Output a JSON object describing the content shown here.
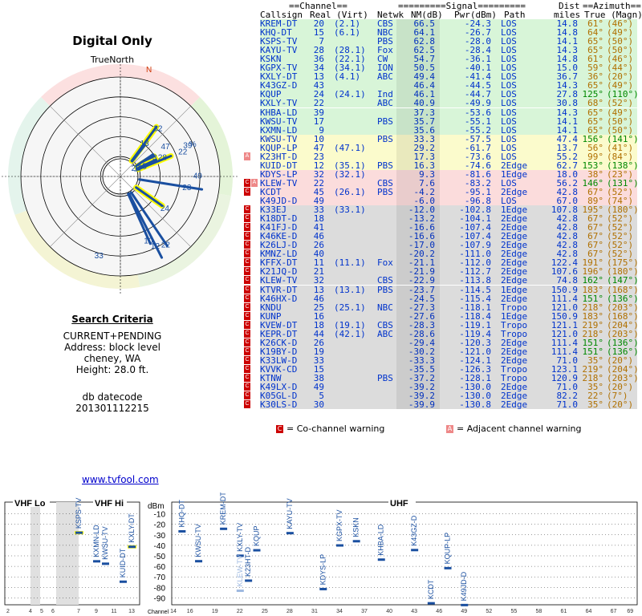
{
  "title": "Digital Only",
  "true_north": "TrueNorth",
  "north_letter": "N",
  "criteria": {
    "heading": "Search Criteria",
    "lines": [
      "CURRENT+PENDING",
      "Address: block level",
      "cheney, WA",
      "Height: 28.0 ft."
    ],
    "db_label": "db datecode",
    "db_code": "201301112215"
  },
  "link": "www.tvfool.com",
  "table": {
    "headers": {
      "channel_group": "==Channel==",
      "signal_group": "=========Signal=========",
      "dist": "Dist",
      "azimuth_group": "==Azimuth==",
      "callsign": "Callsign",
      "real_virt": "Real (Virt)",
      "netwk": "Netwk",
      "nm": "NM(dB)",
      "pwr": "Pwr(dBm)",
      "path": "Path",
      "miles": "miles",
      "true_magn": "True (Magn)"
    },
    "rows": [
      {
        "call": "KREM-DT",
        "real": "20",
        "virt": "(2.1)",
        "net": "CBS",
        "nm": "66.5",
        "pwr": "-24.3",
        "path": "LOS",
        "dist": "14.8",
        "tru": "61°",
        "mag": "(46°)",
        "warn": "",
        "bg": "#d8f5d8"
      },
      {
        "call": "KHQ-DT",
        "real": "15",
        "virt": "(6.1)",
        "net": "NBC",
        "nm": "64.1",
        "pwr": "-26.7",
        "path": "LOS",
        "dist": "14.8",
        "tru": "64°",
        "mag": "(49°)",
        "warn": "",
        "bg": "#d8f5d8"
      },
      {
        "call": "KSPS-TV",
        "real": "7",
        "virt": "",
        "net": "PBS",
        "nm": "62.8",
        "pwr": "-28.0",
        "path": "LOS",
        "dist": "14.1",
        "tru": "65°",
        "mag": "(50°)",
        "warn": "",
        "bg": "#d8f5d8"
      },
      {
        "call": "KAYU-TV",
        "real": "28",
        "virt": "(28.1)",
        "net": "Fox",
        "nm": "62.5",
        "pwr": "-28.4",
        "path": "LOS",
        "dist": "14.3",
        "tru": "65°",
        "mag": "(50°)",
        "warn": "",
        "bg": "#d8f5d8"
      },
      {
        "call": "KSKN",
        "real": "36",
        "virt": "(22.1)",
        "net": "CW",
        "nm": "54.7",
        "pwr": "-36.1",
        "path": "LOS",
        "dist": "14.8",
        "tru": "61°",
        "mag": "(46°)",
        "warn": "",
        "bg": "#d8f5d8"
      },
      {
        "call": "KGPX-TV",
        "real": "34",
        "virt": "(34.1)",
        "net": "ION",
        "nm": "50.5",
        "pwr": "-40.1",
        "path": "LOS",
        "dist": "15.0",
        "tru": "59°",
        "mag": "(44°)",
        "warn": "",
        "bg": "#d8f5d8"
      },
      {
        "call": "KXLY-DT",
        "real": "13",
        "virt": "(4.1)",
        "net": "ABC",
        "nm": "49.4",
        "pwr": "-41.4",
        "path": "LOS",
        "dist": "36.7",
        "tru": "36°",
        "mag": "(20°)",
        "warn": "",
        "bg": "#d8f5d8"
      },
      {
        "call": "K43GZ-D",
        "real": "43",
        "virt": "",
        "net": "",
        "nm": "46.4",
        "pwr": "-44.5",
        "path": "LOS",
        "dist": "14.3",
        "tru": "65°",
        "mag": "(49°)",
        "warn": "",
        "bg": "#d8f5d8"
      },
      {
        "call": "KQUP",
        "real": "24",
        "virt": "(24.1)",
        "net": "Ind",
        "nm": "46.1",
        "pwr": "-44.7",
        "path": "LOS",
        "dist": "27.8",
        "tru": "125°",
        "mag": "(110°)",
        "warn": "",
        "bg": "#d8f5d8"
      },
      {
        "call": "KXLY-TV",
        "real": "22",
        "virt": "",
        "net": "ABC",
        "nm": "40.9",
        "pwr": "-49.9",
        "path": "LOS",
        "dist": "30.8",
        "tru": "68°",
        "mag": "(52°)",
        "warn": "",
        "bg": "#d8f5d8"
      },
      {
        "call": "KHBA-LD",
        "real": "39",
        "virt": "",
        "net": "",
        "nm": "37.3",
        "pwr": "-53.6",
        "path": "LOS",
        "dist": "14.3",
        "tru": "65°",
        "mag": "(49°)",
        "warn": "",
        "bg": "#d8f5d8"
      },
      {
        "call": "KWSU-TV",
        "real": "17",
        "virt": "",
        "net": "PBS",
        "nm": "35.7",
        "pwr": "-55.1",
        "path": "LOS",
        "dist": "14.1",
        "tru": "65°",
        "mag": "(50°)",
        "warn": "",
        "bg": "#d8f5d8"
      },
      {
        "call": "KXMN-LD",
        "real": "9",
        "virt": "",
        "net": "",
        "nm": "35.6",
        "pwr": "-55.2",
        "path": "LOS",
        "dist": "14.1",
        "tru": "65°",
        "mag": "(50°)",
        "warn": "",
        "bg": "#d8f5d8"
      },
      {
        "call": "KWSU-TV",
        "real": "10",
        "virt": "",
        "net": "PBS",
        "nm": "33.3",
        "pwr": "-57.5",
        "path": "LOS",
        "dist": "47.4",
        "tru": "156°",
        "mag": "(141°)",
        "warn": "",
        "bg": "#fbfbcc"
      },
      {
        "call": "KQUP-LP",
        "real": "47",
        "virt": "(47.1)",
        "net": "",
        "nm": "29.2",
        "pwr": "-61.7",
        "path": "LOS",
        "dist": "13.7",
        "tru": "56°",
        "mag": "(41°)",
        "warn": "",
        "bg": "#fbfbcc"
      },
      {
        "call": "K23HT-D",
        "real": "23",
        "virt": "",
        "net": "",
        "nm": "17.3",
        "pwr": "-73.6",
        "path": "LOS",
        "dist": "55.2",
        "tru": "99°",
        "mag": "(84°)",
        "warn": "A",
        "bg": "#fbfbcc"
      },
      {
        "call": "KUID-DT",
        "real": "12",
        "virt": "(35.1)",
        "net": "PBS",
        "nm": "16.3",
        "pwr": "-74.6",
        "path": "2Edge",
        "dist": "62.7",
        "tru": "153°",
        "mag": "(138°)",
        "warn": "",
        "bg": "#fbfbcc"
      },
      {
        "call": "KDYS-LP",
        "real": "32",
        "virt": "(32.1)",
        "net": "",
        "nm": "9.3",
        "pwr": "-81.6",
        "path": "1Edge",
        "dist": "18.0",
        "tru": "38°",
        "mag": "(23°)",
        "warn": "",
        "bg": "#fbdcdc"
      },
      {
        "call": "KLEW-TV",
        "real": "22",
        "virt": "",
        "net": "CBS",
        "nm": "7.6",
        "pwr": "-83.2",
        "path": "LOS",
        "dist": "56.2",
        "tru": "146°",
        "mag": "(131°)",
        "warn": "CA",
        "bg": "#fbdcdc"
      },
      {
        "call": "KCDT",
        "real": "45",
        "virt": "(26.1)",
        "net": "PBS",
        "nm": "-4.2",
        "pwr": "-95.1",
        "path": "2Edge",
        "dist": "42.8",
        "tru": "67°",
        "mag": "(52°)",
        "warn": "C",
        "bg": "#fbdcdc"
      },
      {
        "call": "K49JD-D",
        "real": "49",
        "virt": "",
        "net": "",
        "nm": "-6.0",
        "pwr": "-96.8",
        "path": "LOS",
        "dist": "67.0",
        "tru": "89°",
        "mag": "(74°)",
        "warn": "",
        "bg": "#fbdcdc"
      },
      {
        "call": "K33EJ",
        "real": "33",
        "virt": "(33.1)",
        "net": "",
        "nm": "-12.0",
        "pwr": "-102.8",
        "path": "1Edge",
        "dist": "107.8",
        "tru": "195°",
        "mag": "(180°)",
        "warn": "C",
        "bg": "#dcdcdc"
      },
      {
        "call": "K18DT-D",
        "real": "18",
        "virt": "",
        "net": "",
        "nm": "-13.2",
        "pwr": "-104.1",
        "path": "2Edge",
        "dist": "42.8",
        "tru": "67°",
        "mag": "(52°)",
        "warn": "C",
        "bg": "#dcdcdc"
      },
      {
        "call": "K41FJ-D",
        "real": "41",
        "virt": "",
        "net": "",
        "nm": "-16.6",
        "pwr": "-107.4",
        "path": "2Edge",
        "dist": "42.8",
        "tru": "67°",
        "mag": "(52°)",
        "warn": "C",
        "bg": "#dcdcdc"
      },
      {
        "call": "K46KE-D",
        "real": "46",
        "virt": "",
        "net": "",
        "nm": "-16.6",
        "pwr": "-107.4",
        "path": "2Edge",
        "dist": "42.8",
        "tru": "67°",
        "mag": "(52°)",
        "warn": "C",
        "bg": "#dcdcdc"
      },
      {
        "call": "K26LJ-D",
        "real": "26",
        "virt": "",
        "net": "",
        "nm": "-17.0",
        "pwr": "-107.9",
        "path": "2Edge",
        "dist": "42.8",
        "tru": "67°",
        "mag": "(52°)",
        "warn": "C",
        "bg": "#dcdcdc"
      },
      {
        "call": "KMNZ-LD",
        "real": "40",
        "virt": "",
        "net": "",
        "nm": "-20.2",
        "pwr": "-111.0",
        "path": "2Edge",
        "dist": "42.8",
        "tru": "67°",
        "mag": "(52°)",
        "warn": "C",
        "bg": "#dcdcdc"
      },
      {
        "call": "KFFX-DT",
        "real": "11",
        "virt": "(11.1)",
        "net": "Fox",
        "nm": "-21.1",
        "pwr": "-112.0",
        "path": "2Edge",
        "dist": "122.4",
        "tru": "191°",
        "mag": "(175°)",
        "warn": "C",
        "bg": "#dcdcdc"
      },
      {
        "call": "K21JQ-D",
        "real": "21",
        "virt": "",
        "net": "",
        "nm": "-21.9",
        "pwr": "-112.7",
        "path": "2Edge",
        "dist": "107.6",
        "tru": "196°",
        "mag": "(180°)",
        "warn": "C",
        "bg": "#dcdcdc"
      },
      {
        "call": "KLEW-TV",
        "real": "32",
        "virt": "",
        "net": "CBS",
        "nm": "-22.9",
        "pwr": "-113.8",
        "path": "2Edge",
        "dist": "74.8",
        "tru": "162°",
        "mag": "(147°)",
        "warn": "C",
        "bg": "#dcdcdc"
      },
      {
        "call": "KTVR-DT",
        "real": "13",
        "virt": "(13.1)",
        "net": "PBS",
        "nm": "-23.7",
        "pwr": "-114.5",
        "path": "1Edge",
        "dist": "150.9",
        "tru": "183°",
        "mag": "(168°)",
        "warn": "C",
        "bg": "#dcdcdc"
      },
      {
        "call": "K46HX-D",
        "real": "46",
        "virt": "",
        "net": "",
        "nm": "-24.5",
        "pwr": "-115.4",
        "path": "2Edge",
        "dist": "111.4",
        "tru": "151°",
        "mag": "(136°)",
        "warn": "C",
        "bg": "#dcdcdc"
      },
      {
        "call": "KNDU",
        "real": "25",
        "virt": "(25.1)",
        "net": "NBC",
        "nm": "-27.3",
        "pwr": "-118.1",
        "path": "Tropo",
        "dist": "121.0",
        "tru": "218°",
        "mag": "(203°)",
        "warn": "C",
        "bg": "#dcdcdc"
      },
      {
        "call": "KUNP",
        "real": "16",
        "virt": "",
        "net": "",
        "nm": "-27.6",
        "pwr": "-118.4",
        "path": "1Edge",
        "dist": "150.9",
        "tru": "183°",
        "mag": "(168°)",
        "warn": "C",
        "bg": "#dcdcdc"
      },
      {
        "call": "KVEW-DT",
        "real": "18",
        "virt": "(19.1)",
        "net": "CBS",
        "nm": "-28.3",
        "pwr": "-119.1",
        "path": "Tropo",
        "dist": "121.1",
        "tru": "219°",
        "mag": "(204°)",
        "warn": "C",
        "bg": "#dcdcdc"
      },
      {
        "call": "KEPR-DT",
        "real": "44",
        "virt": "(42.1)",
        "net": "ABC",
        "nm": "-28.6",
        "pwr": "-119.4",
        "path": "Tropo",
        "dist": "121.0",
        "tru": "218°",
        "mag": "(203°)",
        "warn": "C",
        "bg": "#dcdcdc"
      },
      {
        "call": "K26CK-D",
        "real": "26",
        "virt": "",
        "net": "",
        "nm": "-29.4",
        "pwr": "-120.3",
        "path": "2Edge",
        "dist": "111.4",
        "tru": "151°",
        "mag": "(136°)",
        "warn": "C",
        "bg": "#dcdcdc"
      },
      {
        "call": "K19BY-D",
        "real": "19",
        "virt": "",
        "net": "",
        "nm": "-30.2",
        "pwr": "-121.0",
        "path": "2Edge",
        "dist": "111.4",
        "tru": "151°",
        "mag": "(136°)",
        "warn": "C",
        "bg": "#dcdcdc"
      },
      {
        "call": "K33LW-D",
        "real": "33",
        "virt": "",
        "net": "",
        "nm": "-33.3",
        "pwr": "-124.1",
        "path": "2Edge",
        "dist": "71.0",
        "tru": "35°",
        "mag": "(20°)",
        "warn": "C",
        "bg": "#dcdcdc"
      },
      {
        "call": "KVVK-CD",
        "real": "15",
        "virt": "",
        "net": "",
        "nm": "-35.5",
        "pwr": "-126.3",
        "path": "Tropo",
        "dist": "123.1",
        "tru": "219°",
        "mag": "(204°)",
        "warn": "C",
        "bg": "#dcdcdc"
      },
      {
        "call": "KTNW",
        "real": "38",
        "virt": "",
        "net": "PBS",
        "nm": "-37.2",
        "pwr": "-128.1",
        "path": "Tropo",
        "dist": "120.9",
        "tru": "218°",
        "mag": "(203°)",
        "warn": "C",
        "bg": "#dcdcdc"
      },
      {
        "call": "K49LX-D",
        "real": "49",
        "virt": "",
        "net": "",
        "nm": "-39.2",
        "pwr": "-130.0",
        "path": "2Edge",
        "dist": "71.0",
        "tru": "35°",
        "mag": "(20°)",
        "warn": "C",
        "bg": "#dcdcdc"
      },
      {
        "call": "K05GL-D",
        "real": "5",
        "virt": "",
        "net": "",
        "nm": "-39.2",
        "pwr": "-130.0",
        "path": "2Edge",
        "dist": "82.2",
        "tru": "22°",
        "mag": "(7°)",
        "warn": "C",
        "bg": "#dcdcdc"
      },
      {
        "call": "K30LS-D",
        "real": "30",
        "virt": "",
        "net": "",
        "nm": "-39.9",
        "pwr": "-130.8",
        "path": "2Edge",
        "dist": "71.0",
        "tru": "35°",
        "mag": "(20°)",
        "warn": "C",
        "bg": "#dcdcdc"
      }
    ],
    "legend_cochannel": "= Co-channel warning",
    "legend_adjacent": "= Adjacent channel warning",
    "legend_c": "C",
    "legend_a": "A"
  },
  "colors": {
    "green": "#d8f5d8",
    "yellow": "#fbfbcc",
    "red": "#fbdcdc",
    "gray": "#dcdcdc",
    "blue_text": "#0033cc",
    "warn_c": "#cc0000",
    "warn_a": "#ee8888",
    "azimuth": "#b07000",
    "azimuth_green": "#008800"
  },
  "chart_data": [
    {
      "type": "scatter",
      "name": "polar",
      "labels": [
        {
          "label": "32",
          "az": 38,
          "r": 0.62
        },
        {
          "label": "47",
          "az": 56,
          "r": 0.55
        },
        {
          "label": "39",
          "az": 65,
          "r": 0.75
        },
        {
          "label": "%",
          "az": 66,
          "r": 0.81
        },
        {
          "label": "13",
          "az": 36,
          "r": 0.42
        },
        {
          "label": "3",
          "az": 62,
          "r": 0.42
        },
        {
          "label": "28",
          "az": 65,
          "r": 0.47
        },
        {
          "label": "22",
          "az": 68,
          "r": 0.68
        },
        {
          "label": "49",
          "az": 89,
          "r": 0.78
        },
        {
          "label": "23",
          "az": 99,
          "r": 0.68
        },
        {
          "label": "20",
          "az": 61,
          "r": 0.18
        },
        {
          "label": "17",
          "az": 65,
          "r": 0.2
        },
        {
          "label": "15",
          "az": 64,
          "r": 0.25
        },
        {
          "label": "24",
          "az": 125,
          "r": 0.55
        },
        {
          "label": "10",
          "az": 156,
          "r": 0.7
        },
        {
          "label": "12",
          "az": 153,
          "r": 0.78
        },
        {
          "label": "22",
          "az": 146,
          "r": 0.82
        },
        {
          "label": "33",
          "az": 195,
          "r": 0.82
        }
      ]
    },
    {
      "type": "bar",
      "name": "spectrum",
      "groups": [
        "VHF Lo",
        "VHF Hi",
        "UHF"
      ],
      "ylabel": "dBm",
      "xlabel": "Channel",
      "yticks": [
        -10,
        -20,
        -30,
        -40,
        -50,
        -60,
        -70,
        -80,
        -90
      ],
      "xticks": [
        "2",
        "4",
        "5",
        "6",
        "7",
        "9",
        "11",
        "13",
        "14",
        "16",
        "19",
        "22",
        "25",
        "28",
        "31",
        "34",
        "37",
        "40",
        "43",
        "46",
        "49",
        "52",
        "55",
        "58",
        "61",
        "64",
        "67",
        "69"
      ],
      "stations": [
        {
          "ch": 7,
          "call": "KSPS-TV",
          "pwr": -28.0
        },
        {
          "ch": 9,
          "call": "KXMN-LD",
          "pwr": -55.2
        },
        {
          "ch": 10,
          "call": "KWSU-TV",
          "pwr": -57.5
        },
        {
          "ch": 12,
          "call": "KUID-DT",
          "pwr": -74.6
        },
        {
          "ch": 13,
          "call": "KXLY-DT",
          "pwr": -41.4
        },
        {
          "ch": 15,
          "call": "KHQ-DT",
          "pwr": -26.7
        },
        {
          "ch": 17,
          "call": "KWSU-TV",
          "pwr": -55.1
        },
        {
          "ch": 20,
          "call": "KREM-DT",
          "pwr": -24.3
        },
        {
          "ch": 22,
          "call": "KXLY-TV",
          "pwr": -49.9
        },
        {
          "ch": 22,
          "call": "KLEW-TV",
          "pwr": -83.2
        },
        {
          "ch": 23,
          "call": "K23HT-D",
          "pwr": -73.6
        },
        {
          "ch": 24,
          "call": "KQUP",
          "pwr": -44.7
        },
        {
          "ch": 28,
          "call": "KAYU-TV",
          "pwr": -28.4
        },
        {
          "ch": 32,
          "call": "KDYS-LP",
          "pwr": -81.6
        },
        {
          "ch": 34,
          "call": "KGPX-TV",
          "pwr": -40.1
        },
        {
          "ch": 36,
          "call": "KSKN",
          "pwr": -36.1
        },
        {
          "ch": 39,
          "call": "KHBA-LD",
          "pwr": -53.6
        },
        {
          "ch": 43,
          "call": "K43GZ-D",
          "pwr": -44.5
        },
        {
          "ch": 45,
          "call": "KCDT",
          "pwr": -95.1
        },
        {
          "ch": 47,
          "call": "KQUP-LP",
          "pwr": -61.7
        },
        {
          "ch": 49,
          "call": "K49JD-D",
          "pwr": -96.8
        }
      ]
    }
  ]
}
